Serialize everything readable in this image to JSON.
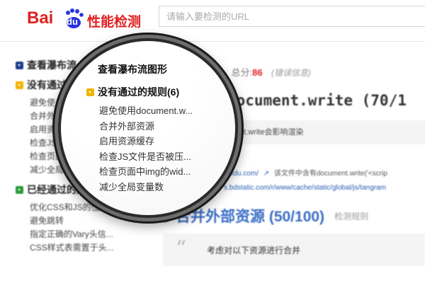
{
  "header": {
    "logo_bai": "Bai",
    "logo_du": "du",
    "logo_name": "性能检测",
    "search_placeholder": "请输入要检测的URL"
  },
  "sidebar": {
    "view_waterfall": "查看瀑布流",
    "failed_title": "没有通过",
    "failed_items": [
      "避免使",
      "合并外",
      "启用资",
      "检查JS",
      "检查页面",
      "减少全局变"
    ],
    "passed_title": "已经通过的规则",
    "passed_items": [
      "优化CSS和JS的位置",
      "避免跳转",
      "指定正确的Vary头信...",
      "CSS样式表需置于头..."
    ]
  },
  "main": {
    "result_suffix": "果",
    "score_label": "总分:",
    "score": "86",
    "error_info": "(错误信息)",
    "rule1_title": "用document.write (70/1",
    "rule1_desc": "nt.write会影响渲染",
    "link1_url": "baidu.com/",
    "link1_note": "该文件中含有document.write('<scrip",
    "link2_url": "s.bdstatic.com/r/www/cache/static/global/js/tangram",
    "rule2_title": "合并外部资源 (50/100)",
    "rule2_link": "检测规则",
    "rule2_desc": "考虑对以下资源进行合并"
  },
  "magnifier": {
    "view_waterfall": "查看瀑布流图形",
    "failed_title": "没有通过的规则(6)",
    "items": [
      "避免使用document.w...",
      "合并外部资源",
      "启用资源缓存",
      "检查JS文件是否被压...",
      "检查页面中img的wid...",
      "减少全局变量数"
    ]
  }
}
